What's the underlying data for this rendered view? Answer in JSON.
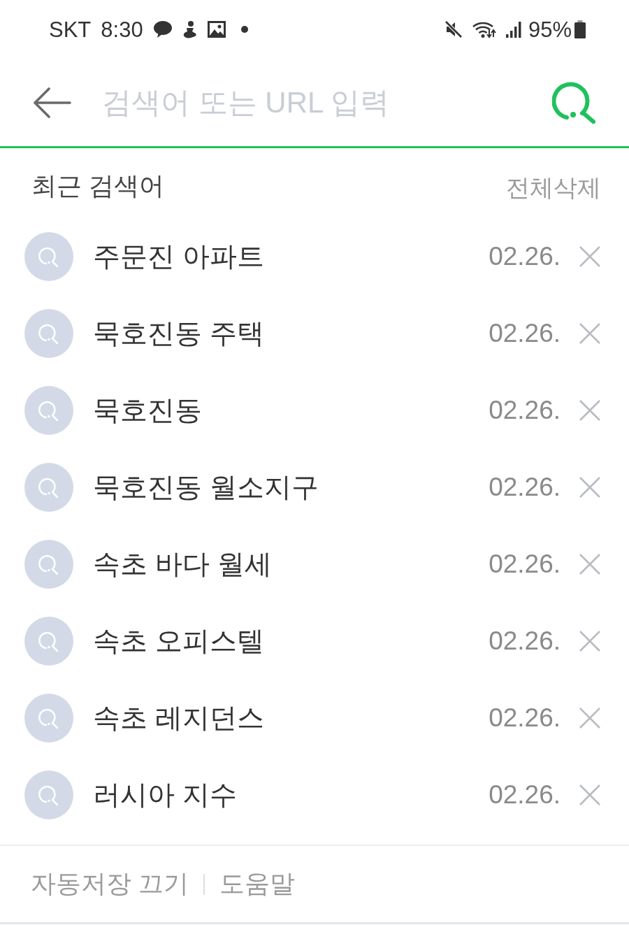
{
  "status_bar": {
    "carrier": "SKT",
    "time": "8:30",
    "battery": "95%"
  },
  "search_bar": {
    "placeholder": "검색어 또는 URL 입력"
  },
  "recent": {
    "title": "최근 검색어",
    "clear_all": "전체삭제",
    "items": [
      {
        "query": "주문진 아파트",
        "date": "02.26."
      },
      {
        "query": "묵호진동 주택",
        "date": "02.26."
      },
      {
        "query": "묵호진동",
        "date": "02.26."
      },
      {
        "query": "묵호진동 월소지구",
        "date": "02.26."
      },
      {
        "query": "속초 바다 월세",
        "date": "02.26."
      },
      {
        "query": "속초 오피스텔",
        "date": "02.26."
      },
      {
        "query": "속초 레지던스",
        "date": "02.26."
      },
      {
        "query": "러시아 지수",
        "date": "02.26."
      }
    ]
  },
  "footer": {
    "links": [
      {
        "label": "자동저장 끄기"
      },
      {
        "label": "도움말"
      }
    ]
  }
}
